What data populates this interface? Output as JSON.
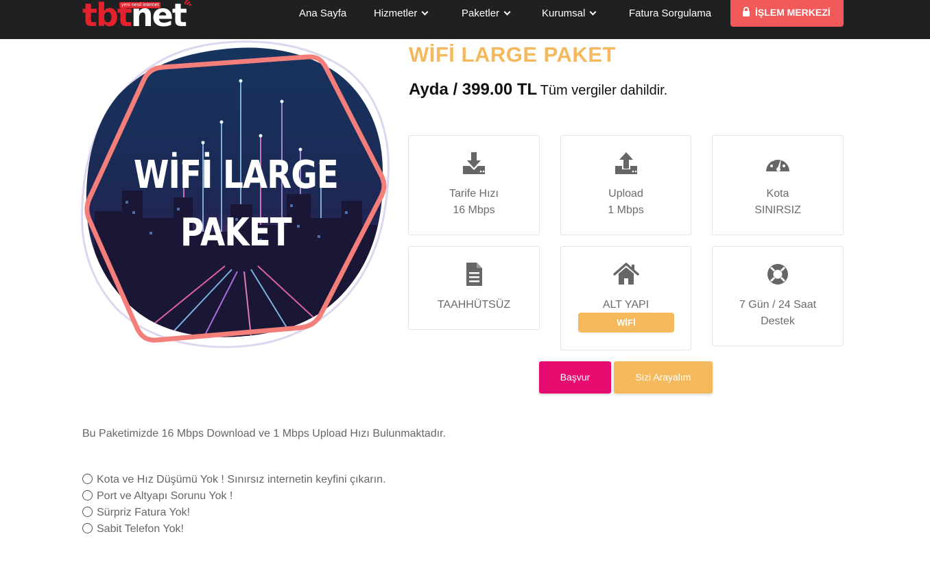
{
  "brand": {
    "logo_red": "tbt",
    "logo_white": "net",
    "tagline": "yeni nesil internet",
    "red": "#e3222d"
  },
  "nav": {
    "items": [
      {
        "label": "Ana Sayfa",
        "dropdown": false
      },
      {
        "label": "Hizmetler",
        "dropdown": true
      },
      {
        "label": "Paketler",
        "dropdown": true
      },
      {
        "label": "Kurumsal",
        "dropdown": true
      },
      {
        "label": "Fatura Sorgulama",
        "dropdown": false
      }
    ],
    "cta_label": "İŞLEM MERKEZİ",
    "cta_icon": "lock-icon",
    "cta_color": "#f05a5b",
    "bg": "#1f2022"
  },
  "hero": {
    "line1": "WİFİ LARGE",
    "line2": "PAKET"
  },
  "package": {
    "title": "WİFİ LARGE PAKET",
    "price": "Ayda / 399.00 TL",
    "price_note": "Tüm vergiler dahildir.",
    "title_color": "#f4b95d"
  },
  "features": [
    {
      "icon": "download-icon",
      "line1": "Tarife Hızı",
      "line2": "16 Mbps"
    },
    {
      "icon": "upload-icon",
      "line1": "Upload",
      "line2": "1 Mbps"
    },
    {
      "icon": "speedometer-icon",
      "line1": "Kota",
      "line2": "SINIRSIZ"
    },
    {
      "icon": "document-icon",
      "line1": "TAAHHÜTSÜZ"
    },
    {
      "icon": "home-icon",
      "line1": "ALT YAPI",
      "badge": "WİFİ"
    },
    {
      "icon": "lifebuoy-icon",
      "line1": "7 Gün / 24 Saat",
      "line2": "Destek"
    }
  ],
  "actions": {
    "apply_label": "Başvur",
    "call_label": "Sizi Arayalım",
    "apply_color": "#e60b6e",
    "call_color": "#f4b95d"
  },
  "description": "Bu Paketimizde 16 Mbps Download ve 1 Mbps Upload Hızı Bulunmaktadır.",
  "bullets": [
    "Kota ve Hız Düşümü Yok ! Sınırsız internetin keyfini çıkarın.",
    "Port ve Altyapı Sorunu Yok !",
    "Sürpriz Fatura Yok!",
    "Sabit Telefon Yok!"
  ]
}
